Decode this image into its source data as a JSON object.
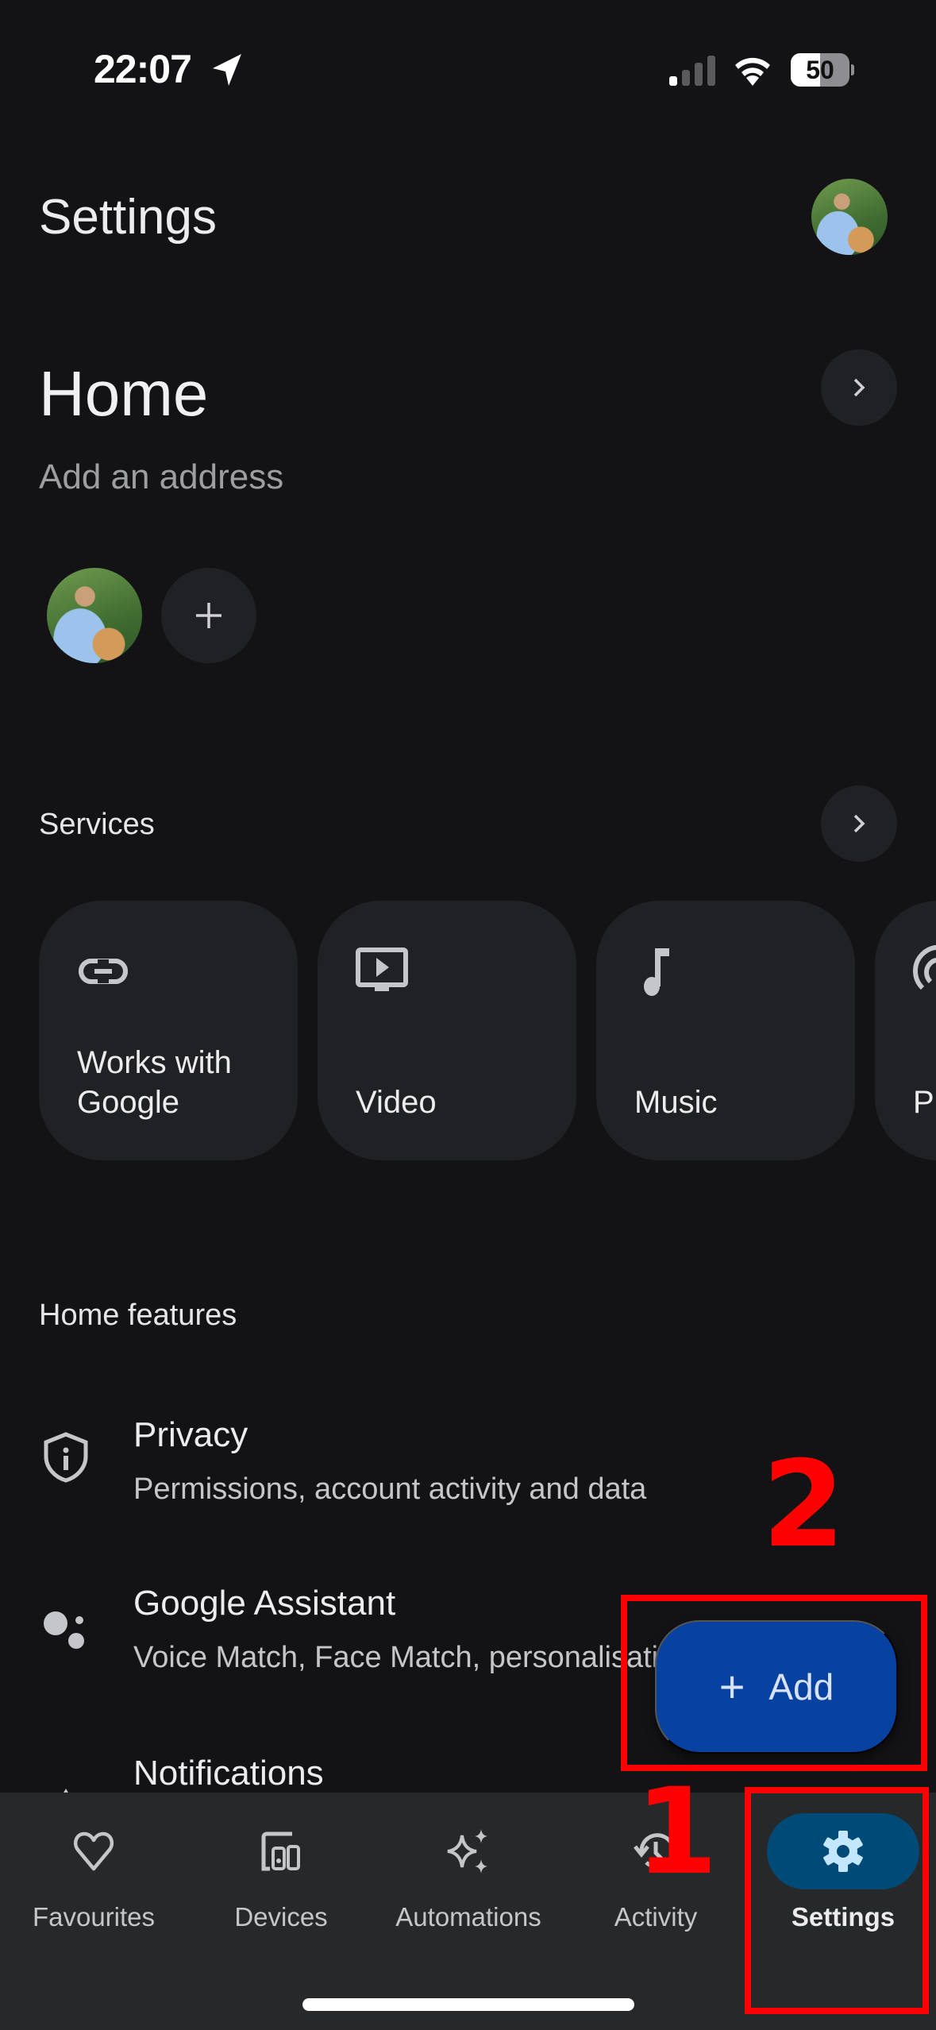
{
  "status_bar": {
    "time": "22:07",
    "location_icon": "location-arrow-icon",
    "signal_icon": "cellular-signal-icon",
    "wifi_icon": "wifi-icon",
    "battery_percent": "50",
    "battery_level": 0.5
  },
  "header": {
    "title": "Settings",
    "avatar": "profile-avatar"
  },
  "home": {
    "title": "Home",
    "address_prompt": "Add an address",
    "add_member_icon": "plus-icon"
  },
  "services": {
    "title": "Services",
    "cards": [
      {
        "label": "Works with Google",
        "icon": "link-icon"
      },
      {
        "label": "Video",
        "icon": "video-icon"
      },
      {
        "label": "Music",
        "icon": "music-note-icon"
      },
      {
        "label": "P",
        "icon": "podcast-icon"
      }
    ]
  },
  "home_features": {
    "title": "Home features",
    "items": [
      {
        "title": "Privacy",
        "subtitle": "Permissions, account activity and data",
        "icon": "shield-info-icon"
      },
      {
        "title": "Google Assistant",
        "subtitle": "Voice Match, Face Match, personalisation",
        "icon": "google-assistant-icon"
      },
      {
        "title": "Notifications",
        "subtitle": "",
        "icon": "bell-icon"
      }
    ]
  },
  "fab": {
    "label": "Add",
    "icon": "plus-icon",
    "color": "#0842a0"
  },
  "bottom_nav": {
    "items": [
      {
        "label": "Favourites",
        "icon": "heart-icon",
        "active": false
      },
      {
        "label": "Devices",
        "icon": "devices-icon",
        "active": false
      },
      {
        "label": "Automations",
        "icon": "sparkle-icon",
        "active": false
      },
      {
        "label": "Activity",
        "icon": "history-icon",
        "active": false
      },
      {
        "label": "Settings",
        "icon": "gear-icon",
        "active": true
      }
    ],
    "active_color": "#004a77"
  },
  "annotations": {
    "step_1": "1",
    "step_2": "2",
    "color": "#ff0000"
  }
}
